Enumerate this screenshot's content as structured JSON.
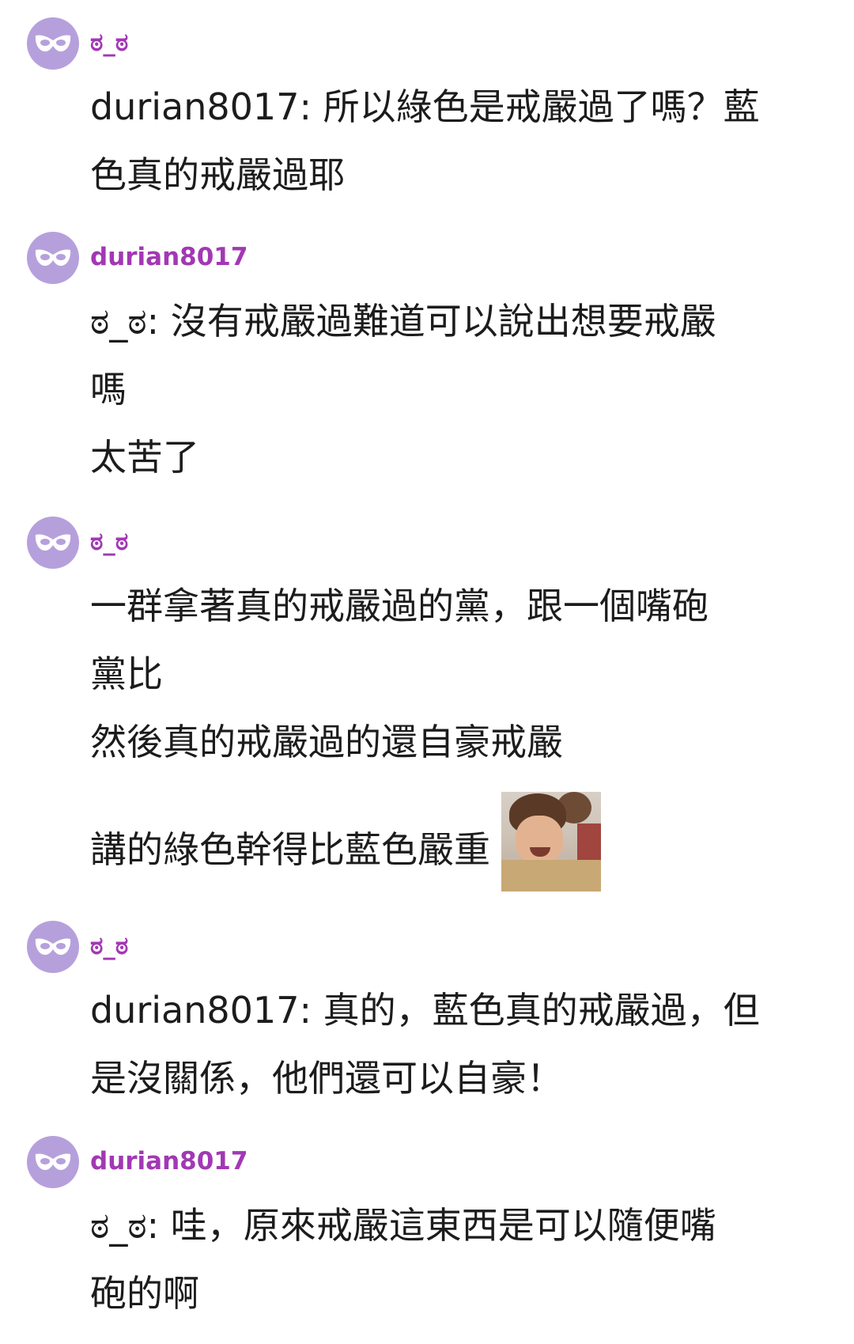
{
  "colors": {
    "author": "#a238b4",
    "avatar_bg": "#b6a0dc",
    "text": "#1c1c1c",
    "background": "#ffffff"
  },
  "avatar_icon": "mask-icon",
  "comments": [
    {
      "author": "ಠ_ಠ",
      "lines": [
        "durian8017: 所以綠色是戒嚴過了嗎？藍",
        "色真的戒嚴過耶"
      ]
    },
    {
      "author": "durian8017",
      "lines": [
        "ಠ_ಠ: 沒有戒嚴過難道可以說出想要戒嚴",
        "嗎",
        "太苦了"
      ]
    },
    {
      "author": "ಠ_ಠ",
      "lines": [
        "一群拿著真的戒嚴過的黨，跟一個嘴砲",
        "黨比",
        "然後真的戒嚴過的還自豪戒嚴"
      ],
      "sticker_line": "講的綠色幹得比藍色嚴重",
      "sticker": "laughing-man-sticker"
    },
    {
      "author": "ಠ_ಠ",
      "lines": [
        "durian8017: 真的，藍色真的戒嚴過，但",
        "是沒關係，他們還可以自豪！"
      ]
    },
    {
      "author": "durian8017",
      "lines": [
        "ಠ_ಠ: 哇，原來戒嚴這東西是可以隨便嘴",
        "砲的啊"
      ]
    }
  ]
}
